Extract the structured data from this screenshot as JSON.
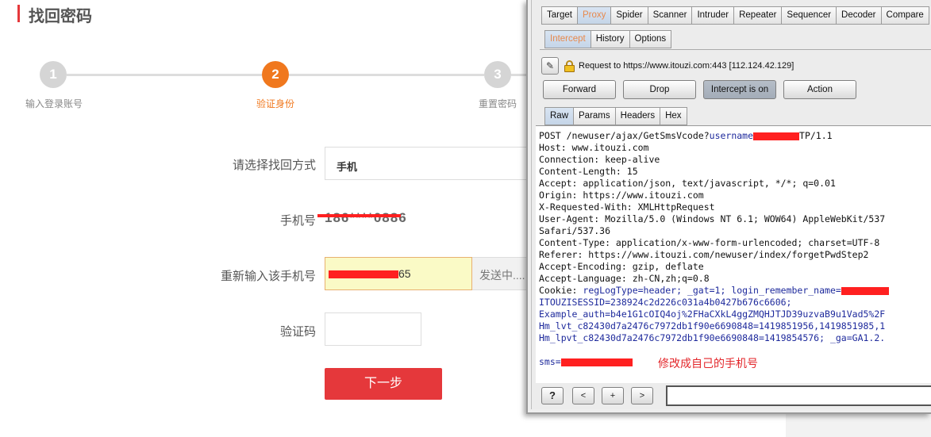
{
  "web": {
    "page_title": "找回密码",
    "steps": [
      {
        "number": "1",
        "label": "输入登录账号"
      },
      {
        "number": "2",
        "label": "验证身份"
      },
      {
        "number": "3",
        "label": "重置密码"
      }
    ],
    "form": {
      "method_label": "请选择找回方式",
      "method_value": "手机",
      "phone_label": "手机号",
      "phone_value": "186****0886",
      "reenter_label": "重新输入该手机号",
      "reenter_value": "65",
      "send_label": "发送中....",
      "code_label": "验证码",
      "next_label": "下一步"
    }
  },
  "burp": {
    "tool_tabs": [
      "Target",
      "Proxy",
      "Spider",
      "Scanner",
      "Intruder",
      "Repeater",
      "Sequencer",
      "Decoder",
      "Compare"
    ],
    "active_tool_tab": "Proxy",
    "proxy_tabs": [
      "Intercept",
      "History",
      "Options"
    ],
    "request_info": "Request to https://www.itouzi.com:443  [112.124.42.129]",
    "buttons": {
      "forward": "Forward",
      "drop": "Drop",
      "intercept": "Intercept is on",
      "action": "Action"
    },
    "message_tabs": [
      "Raw",
      "Params",
      "Headers",
      "Hex"
    ],
    "request_lines": {
      "l1_a": "POST /newuser/ajax/GetSmsVcode?",
      "l1_b": "username",
      "l1_c": "TP/1.1",
      "l2": "Host: www.itouzi.com",
      "l3": "Connection: keep-alive",
      "l4": "Content-Length: 15",
      "l5": "Accept: application/json, text/javascript, */*; q=0.01",
      "l6": "Origin: https://www.itouzi.com",
      "l7": "X-Requested-With: XMLHttpRequest",
      "l8": "User-Agent: Mozilla/5.0 (Windows NT 6.1; WOW64) AppleWebKit/537",
      "l9": "Safari/537.36",
      "l10": "Content-Type: application/x-www-form-urlencoded; charset=UTF-8",
      "l11": "Referer: https://www.itouzi.com/newuser/index/forgetPwdStep2",
      "l12": "Accept-Encoding: gzip, deflate",
      "l13": "Accept-Language: zh-CN,zh;q=0.8",
      "l14_a": "Cookie: ",
      "l14_b": "regLogType=header; _gat=1; login_remember_name=",
      "l15": "ITOUZISESSID=238924c2d226c031a4b0427b676c6606;",
      "l16": "Example_auth=b4e1G1cOIQ4oj%2FHaCXkL4ggZMQHJTJD39uzvaB9u1Vad5%2F",
      "l17": "Hm_lvt_c82430d7a2476c7972db1f90e6690848=1419851956,1419851985,1",
      "l18": "Hm_lpvt_c82430d7a2476c7972db1f90e6690848=1419854576; _ga=GA1.2.",
      "l19": "sms="
    },
    "annotation": "修改成自己的手机号",
    "nav_buttons": [
      "?",
      "<",
      "+",
      ">"
    ]
  }
}
